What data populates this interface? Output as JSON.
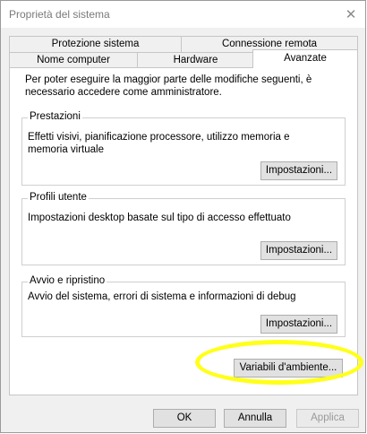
{
  "window": {
    "title": "Proprietà del sistema",
    "close_symbol": "✕"
  },
  "tabs": {
    "top_row": [
      "Protezione sistema",
      "Connessione remota"
    ],
    "bottom_row": [
      "Nome computer",
      "Hardware",
      "Avanzate"
    ],
    "selected": "Avanzate"
  },
  "panel": {
    "intro": "Per poter eseguire la maggior parte delle modifiche seguenti, è necessario accedere come amministratore.",
    "groups": [
      {
        "title": "Prestazioni",
        "text": "Effetti visivi, pianificazione processore, utilizzo memoria e memoria virtuale",
        "button": "Impostazioni..."
      },
      {
        "title": "Profili utente",
        "text": "Impostazioni desktop basate sul tipo di accesso effettuato",
        "button": "Impostazioni..."
      },
      {
        "title": "Avvio e ripristino",
        "text": "Avvio del sistema, errori di sistema e informazioni di debug",
        "button": "Impostazioni..."
      }
    ],
    "env_button": "Variabili d'ambiente..."
  },
  "footer": {
    "ok": "OK",
    "cancel": "Annulla",
    "apply": "Applica"
  },
  "colors": {
    "highlight": "#ffff1a",
    "window_bg": "#f0f0f0",
    "panel_bg": "#ffffff"
  }
}
